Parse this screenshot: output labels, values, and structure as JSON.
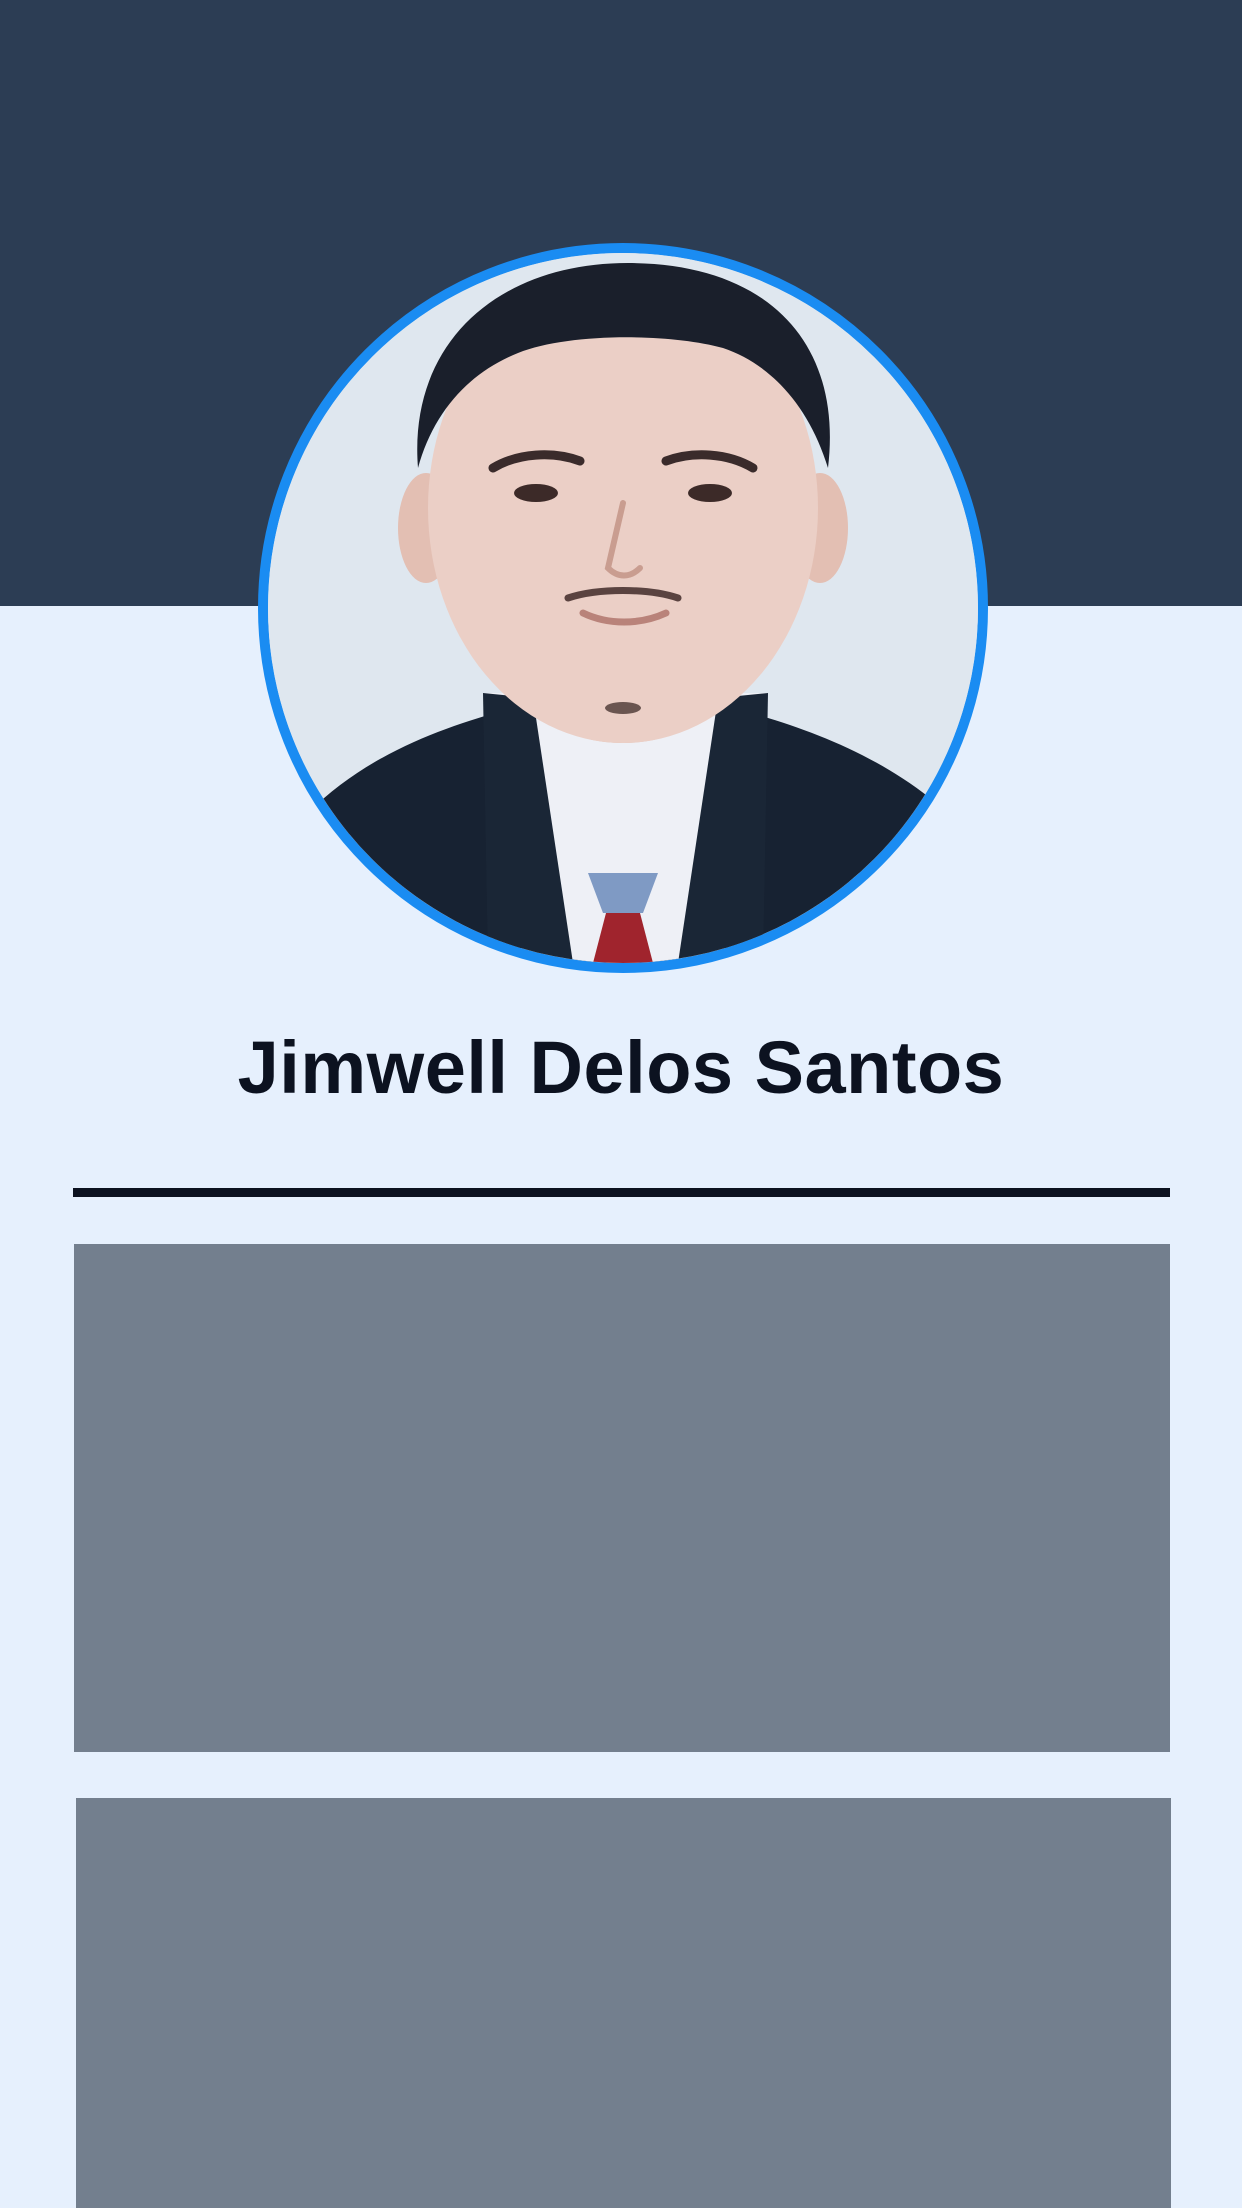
{
  "profile": {
    "name": "Jimwell Delos Santos",
    "photo_description_icon": "profile-photo"
  },
  "colors": {
    "header_background": "#2c3d54",
    "page_background": "#e6f0fd",
    "avatar_border": "#1a8cf2",
    "name_text": "#0c1220",
    "divider": "#0c1220",
    "card_placeholder": "#737f8e"
  },
  "content": {
    "cards": [
      {
        "state": "loading-placeholder"
      },
      {
        "state": "loading-placeholder"
      }
    ]
  }
}
